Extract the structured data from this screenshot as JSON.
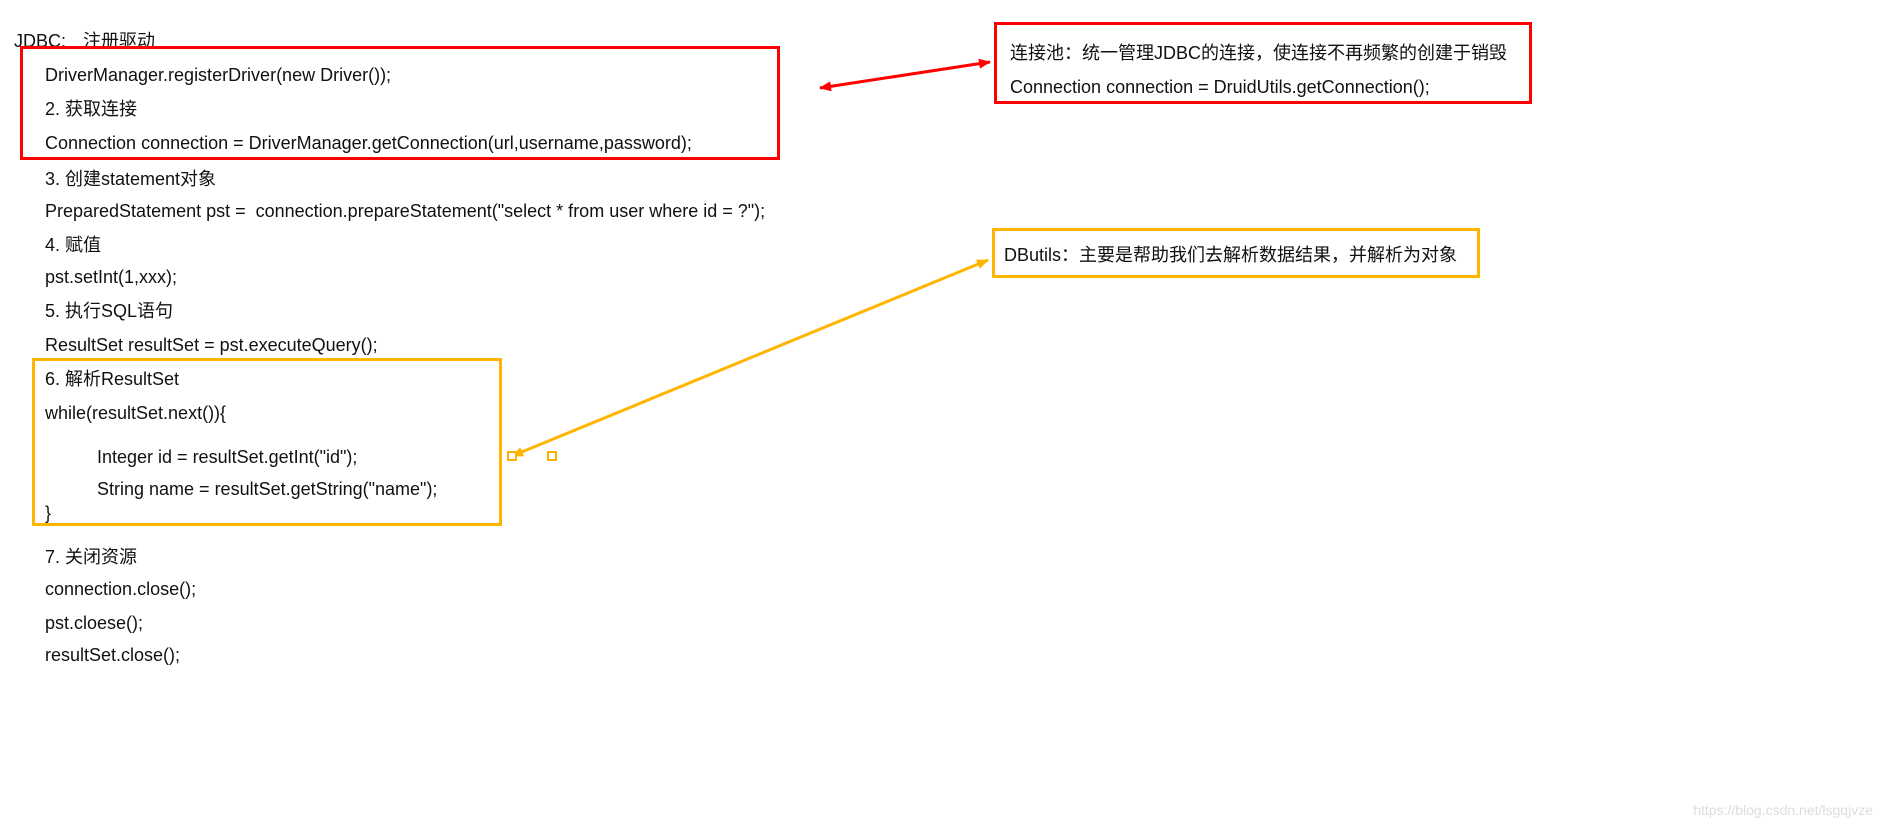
{
  "header": {
    "label": "JDBC:"
  },
  "jdbc_steps": {
    "s1_title": "注册驱动",
    "s1_code": "DriverManager.registerDriver(new Driver());",
    "s2_title": "2. 获取连接",
    "s2_code": "Connection connection = DriverManager.getConnection(url,username,password);",
    "s3_title": "3. 创建statement对象",
    "s3_code": "PreparedStatement pst =  connection.prepareStatement(\"select * from user where id = ?\");",
    "s4_title": "4. 赋值",
    "s4_code": "pst.setInt(1,xxx);",
    "s5_title": "5. 执行SQL语句",
    "s5_code": "ResultSet resultSet = pst.executeQuery();",
    "s6_title": "6. 解析ResultSet",
    "s6_code_a": "while(resultSet.next()){",
    "s6_code_b": "Integer id = resultSet.getInt(\"id\");",
    "s6_code_c": "String name = resultSet.getString(\"name\");",
    "s6_code_d": "}",
    "s7_title": "7. 关闭资源",
    "s7_code_a": "connection.close();",
    "s7_code_b": "pst.cloese();",
    "s7_code_c": "resultSet.close();"
  },
  "pool_box": {
    "desc": "连接池：统一管理JDBC的连接，使连接不再频繁的创建于销毁",
    "code": "Connection connection = DruidUtils.getConnection();"
  },
  "dbutils_box": {
    "desc": "DButils：主要是帮助我们去解析数据结果，并解析为对象"
  },
  "colors": {
    "red": "#ff0000",
    "orange": "#ffb400"
  },
  "watermark": "https://blog.csdn.net/lsgqjvze"
}
